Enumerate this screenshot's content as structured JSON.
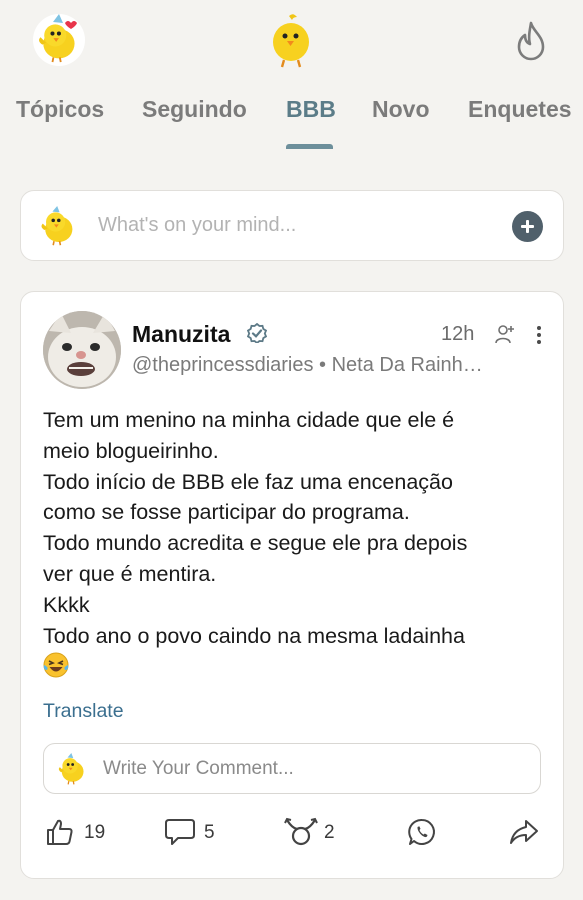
{
  "tabs": {
    "items": [
      "Tópicos",
      "Seguindo",
      "BBB",
      "Novo",
      "Enquetes"
    ],
    "active": "BBB"
  },
  "composer": {
    "placeholder": "What's on your mind..."
  },
  "post": {
    "author": "Manuzita",
    "time": "12h",
    "handle": "@theprincessdiaries • Neta Da Rainh…",
    "body": [
      "Tem um menino na minha cidade que ele é",
      "meio blogueirinho.",
      "Todo início de BBB ele faz uma encenação",
      "como se fosse participar do programa.",
      "Todo mundo acredita e segue ele pra depois",
      "ver que é mentira.",
      "Kkkk",
      "Todo ano o povo caindo na mesma ladainha"
    ],
    "emoji": "😂",
    "translate_label": "Translate",
    "comment_placeholder": "Write Your Comment...",
    "likes": "19",
    "comments": "5",
    "reposts": "2"
  },
  "icons": {
    "avatar": "chick-avatar-icon",
    "logo": "chick-logo-icon",
    "trending": "flame-icon",
    "verified": "verified-badge-icon",
    "follow": "add-user-icon",
    "more": "more-vertical-icon",
    "like": "thumbs-up-icon",
    "comment": "comment-icon",
    "repost": "repost-icon",
    "whatsapp": "whatsapp-icon",
    "share": "share-icon"
  },
  "colors": {
    "background": "#f4f3f0",
    "active_tab": "#5b7c88",
    "inactive_tab": "#7b7b7b",
    "link": "#3b6f8f",
    "chick_yellow": "#f6d02a"
  }
}
